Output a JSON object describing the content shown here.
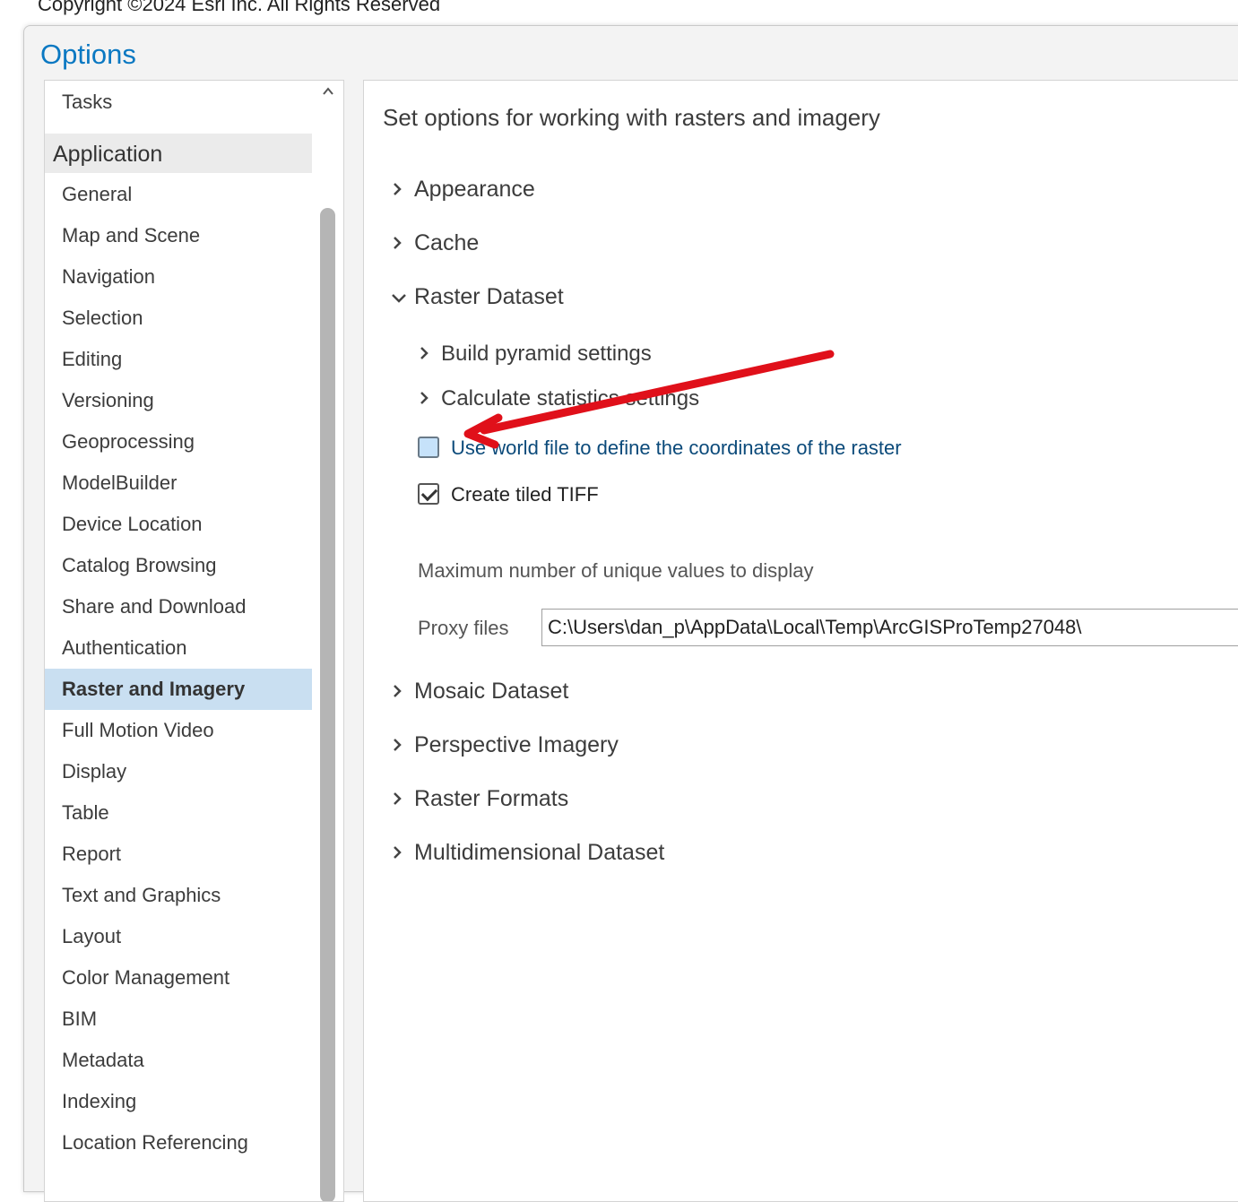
{
  "copyright": "Copyright ©2024 Esri Inc. All Rights Reserved",
  "dialog": {
    "title": "Options"
  },
  "sidebar": {
    "tasks_label": "Tasks",
    "group_header": "Application",
    "items": [
      {
        "label": "General"
      },
      {
        "label": "Map and Scene"
      },
      {
        "label": "Navigation"
      },
      {
        "label": "Selection"
      },
      {
        "label": "Editing"
      },
      {
        "label": "Versioning"
      },
      {
        "label": "Geoprocessing"
      },
      {
        "label": "ModelBuilder"
      },
      {
        "label": "Device Location"
      },
      {
        "label": "Catalog Browsing"
      },
      {
        "label": "Share and Download"
      },
      {
        "label": "Authentication"
      },
      {
        "label": "Raster and Imagery"
      },
      {
        "label": "Full Motion Video"
      },
      {
        "label": "Display"
      },
      {
        "label": "Table"
      },
      {
        "label": "Report"
      },
      {
        "label": "Text and Graphics"
      },
      {
        "label": "Layout"
      },
      {
        "label": "Color Management"
      },
      {
        "label": "BIM"
      },
      {
        "label": "Metadata"
      },
      {
        "label": "Indexing"
      },
      {
        "label": "Location Referencing"
      }
    ],
    "selected_item": "Raster and Imagery"
  },
  "main": {
    "title": "Set options for working with rasters and imagery",
    "sections": {
      "appearance": "Appearance",
      "cache": "Cache",
      "raster_dataset": "Raster Dataset",
      "mosaic_dataset": "Mosaic Dataset",
      "perspective_imagery": "Perspective Imagery",
      "raster_formats": "Raster Formats",
      "multidimensional_dataset": "Multidimensional Dataset"
    },
    "raster_dataset": {
      "build_pyramid": "Build pyramid settings",
      "calc_stats": "Calculate statistics settings",
      "world_file_label": "Use world file to define the coordinates of the raster",
      "world_file_checked": false,
      "tiled_tiff_label": "Create tiled TIFF",
      "tiled_tiff_checked": true,
      "max_unique_label": "Maximum number of unique values to display",
      "proxy_label": "Proxy files",
      "proxy_value": "C:\\Users\\dan_p\\AppData\\Local\\Temp\\ArcGISProTemp27048\\"
    }
  },
  "colors": {
    "accent": "#0a78c2",
    "selected_bg": "#c9dff1",
    "annotation_arrow": "#e0101a",
    "link_text": "#0b4a7a"
  },
  "icons": {
    "collapsed": "chevron-right-icon",
    "expanded": "chevron-down-icon",
    "scroll_up": "chevron-up-icon"
  }
}
